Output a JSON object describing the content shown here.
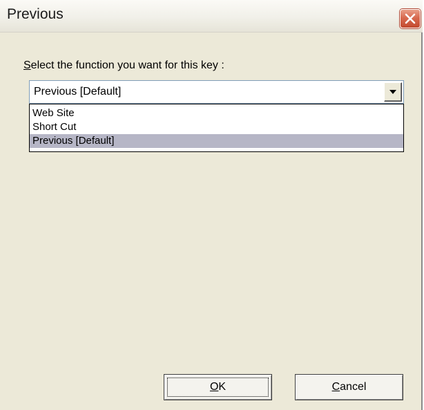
{
  "window": {
    "title": "Previous"
  },
  "dialog": {
    "prompt_mnemonic": "S",
    "prompt_rest": "elect the function you want for this key :",
    "combo_value": "Previous [Default]",
    "options": [
      {
        "label": "Web Site",
        "selected": false
      },
      {
        "label": "Short Cut",
        "selected": false
      },
      {
        "label": "Previous [Default]",
        "selected": true
      }
    ]
  },
  "buttons": {
    "ok_mnemonic": "O",
    "ok_rest": "K",
    "cancel_mnemonic": "C",
    "cancel_rest": "ancel"
  },
  "icons": {
    "close": "close-icon",
    "dropdown_arrow": "chevron-down-icon"
  },
  "colors": {
    "close_button": "#d86a4f",
    "selected_option": "#b6b6c6",
    "dialog_background": "#ece9d8"
  }
}
